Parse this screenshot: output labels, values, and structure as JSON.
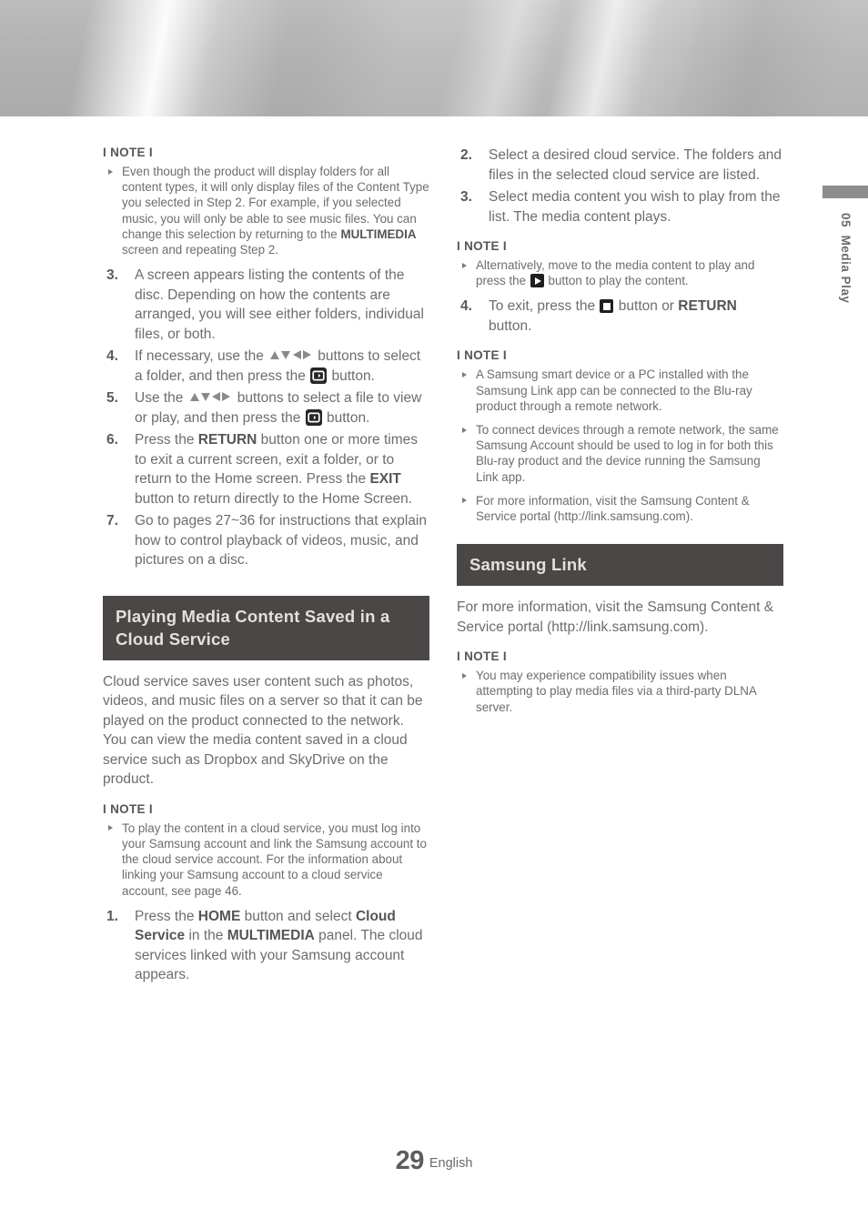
{
  "page": {
    "number": "29",
    "language": "English",
    "chapter_number": "05",
    "chapter_title": "Media Play"
  },
  "labels": {
    "note": "I NOTE I",
    "bullet_icon": "triangle-bullet-icon",
    "enter_icon": "enter-button-icon",
    "play_icon": "play-button-icon",
    "stop_icon": "stop-button-icon",
    "arrows_icon": "direction-arrows-icon"
  },
  "colors": {
    "section_header_bg": "#4a4746",
    "section_header_text": "#e3e1df",
    "body_text": "#6d6d6d",
    "bold_text": "#555555",
    "rail_tab": "#8d8d8d"
  },
  "left_column": {
    "note1_heading": "I NOTE I",
    "note1_bullets": [
      {
        "pre": "Even though the product will display folders for all content types, it will only display files of the Content Type you selected in Step 2. For example, if you selected music, you will only be able to see music files. You can change this selection by returning to the ",
        "bold": "MULTIMEDIA",
        "post": " screen and repeating Step 2."
      }
    ],
    "steps": [
      {
        "n": "3.",
        "text": "A screen appears listing the contents of the disc. Depending on how the contents are arranged, you will see either folders, individual files, or both."
      },
      {
        "n": "4.",
        "pre": "If necessary, use the ",
        "icon1": "arrows",
        "mid": " buttons to select a folder, and then press the ",
        "icon2": "enter",
        "post": " button."
      },
      {
        "n": "5.",
        "pre": "Use the ",
        "icon1": "arrows",
        "mid": " buttons to select a file to view or play, and then press the ",
        "icon2": "enter",
        "post": " button."
      },
      {
        "n": "6.",
        "pre": "Press the ",
        "b1": "RETURN",
        "mid": " button one or more times to exit a current screen, exit a folder, or to return to the Home screen. Press the ",
        "b2": "EXIT",
        "post": " button to return directly to the Home Screen."
      },
      {
        "n": "7.",
        "text": "Go to pages 27~36 for instructions that explain how to control playback of videos, music, and pictures on a disc."
      }
    ],
    "section_heading": "Playing Media Content Saved in a Cloud Service",
    "section_para": "Cloud service saves user content such as photos, videos, and music files on a server so that it can be played on the product connected to the network. You can view the media content saved in a cloud service such as Dropbox and SkyDrive on the product.",
    "note2_heading": "I NOTE I",
    "note2_bullets": [
      "To play the content in a cloud service, you must log into your Samsung account and link the Samsung account to the cloud service account. For the information about linking your Samsung account to a cloud service account, see page 46."
    ],
    "step1": {
      "n": "1.",
      "pre": "Press the ",
      "b1": "HOME",
      "mid1": " button and select ",
      "b2": "Cloud Service",
      "mid2": " in the ",
      "b3": "MULTIMEDIA",
      "post": " panel. The cloud services linked with your Samsung account appears."
    }
  },
  "right_column": {
    "steps_top": [
      {
        "n": "2.",
        "text": "Select a desired cloud service. The folders and files in the selected cloud service are listed."
      },
      {
        "n": "3.",
        "text": "Select media content you wish to play from the list. The media content plays."
      }
    ],
    "note1_heading": "I NOTE I",
    "note1_bullet": {
      "pre": "Alternatively, move to the media content to play and press the ",
      "icon": "play",
      "post": " button to play the content."
    },
    "step4": {
      "n": "4.",
      "pre": "To exit, press the ",
      "icon": "stop",
      "mid": " button or ",
      "bold": "RETURN",
      "post": " button."
    },
    "note2_heading": "I NOTE I",
    "note2_bullets": [
      "A Samsung smart device or a PC installed with the Samsung Link  app can be connected to the Blu-ray product through a remote network.",
      "To connect devices through a remote network, the same Samsung Account should be used to log in for both this Blu-ray product and the device running the Samsung Link app.",
      "For more information, visit the Samsung Content & Service portal (http://link.samsung.com)."
    ],
    "section_heading": "Samsung Link",
    "section_para": "For more information, visit the Samsung Content & Service portal (http://link.samsung.com).",
    "note3_heading": "I NOTE I",
    "note3_bullets": [
      "You may experience compatibility issues when attempting to play media files via a third-party DLNA server."
    ]
  }
}
